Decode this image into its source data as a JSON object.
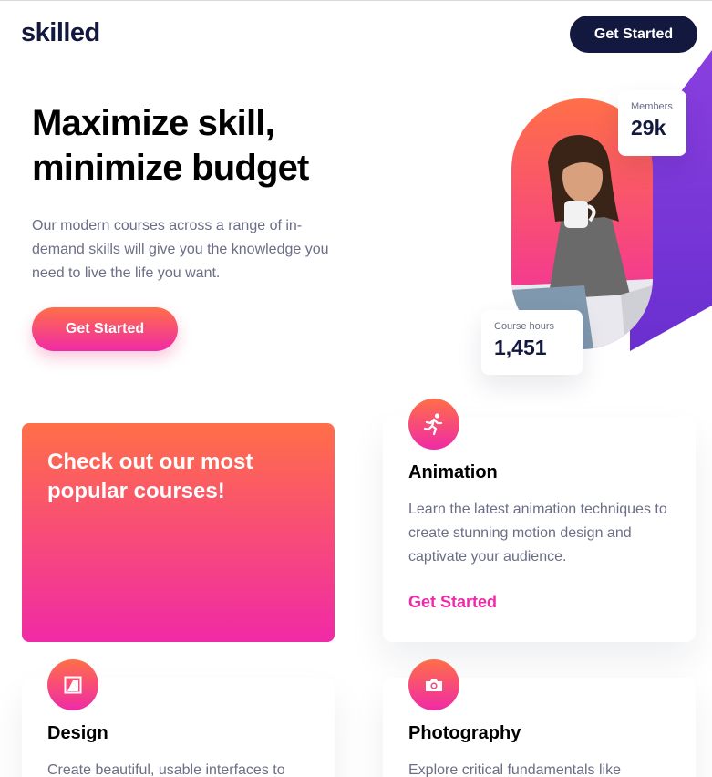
{
  "header": {
    "logo": "skilled",
    "cta_label": "Get Started"
  },
  "hero": {
    "title": "Maximize skill, minimize budget",
    "text": "Our modern courses across a range of in-demand skills will give you the knowledge you need to live the life you want.",
    "cta_label": "Get Started",
    "stats": {
      "members_label": "Members",
      "members_value": "29k",
      "hours_label": "Course hours",
      "hours_value": "1,451"
    }
  },
  "promo": {
    "title": "Check out our most popular courses!"
  },
  "courses": [
    {
      "icon": "running-person-icon",
      "title": "Animation",
      "text": "Learn the latest animation techniques to create stunning motion design and captivate your audience.",
      "link": "Get Started"
    },
    {
      "icon": "design-icon",
      "title": "Design",
      "text": "Create beautiful, usable interfaces to"
    },
    {
      "icon": "camera-icon",
      "title": "Photography",
      "text": "Explore critical fundamentals like"
    }
  ],
  "colors": {
    "navy": "#13183f",
    "gradient_top": "#ff6f48",
    "gradient_bottom": "#f02aa6",
    "purple": "#7f3ee0"
  }
}
